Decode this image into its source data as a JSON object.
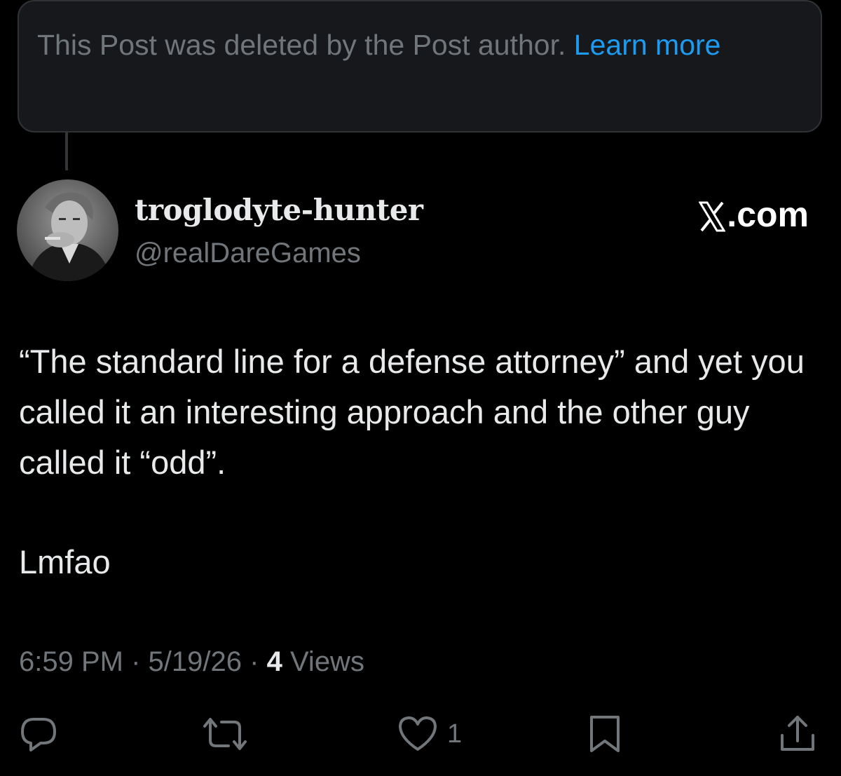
{
  "deleted_notice": {
    "text": "This Post was deleted by the Post author.",
    "link": "Learn more"
  },
  "author": {
    "display_name": "troglodyte-hunter",
    "handle": "@realDareGames"
  },
  "brand": {
    "suffix": ".com",
    "icon": "x-logo-icon"
  },
  "post": {
    "line1": "“The standard line for a defense attorney” and yet you called it an interesting approach and the other guy called it “odd”.",
    "line2": "Lmfao"
  },
  "meta": {
    "time": "6:59 PM",
    "sep1": "·",
    "date": "5/19/26",
    "sep2": "·",
    "views_count": "4",
    "views_label": "Views"
  },
  "actions": {
    "reply_icon": "reply-icon",
    "repost_icon": "repost-icon",
    "like_icon": "heart-icon",
    "like_count": "1",
    "bookmark_icon": "bookmark-icon",
    "share_icon": "share-icon"
  },
  "colors": {
    "background": "#000000",
    "text": "#e7e9ea",
    "muted": "#71767b",
    "link": "#1d9bf0",
    "card": "#16181c",
    "border": "#2f3336"
  }
}
